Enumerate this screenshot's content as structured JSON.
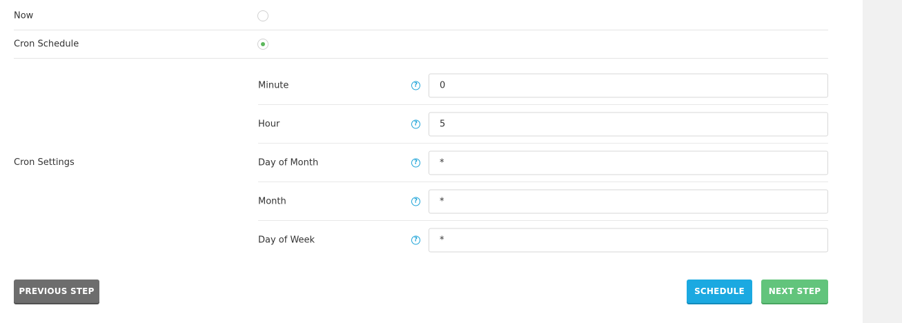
{
  "options": {
    "now_label": "Now",
    "cron_schedule_label": "Cron Schedule",
    "selected": "Cron Schedule"
  },
  "cron": {
    "section_label": "Cron Settings",
    "fields": [
      {
        "label": "Minute",
        "value": "0"
      },
      {
        "label": "Hour",
        "value": "5"
      },
      {
        "label": "Day of Month",
        "value": "*"
      },
      {
        "label": "Month",
        "value": "*"
      },
      {
        "label": "Day of Week",
        "value": "*"
      }
    ],
    "help_icon": "question-circle-icon",
    "help_glyph": "?"
  },
  "buttons": {
    "previous": "PREVIOUS STEP",
    "schedule": "SCHEDULE",
    "next": "NEXT STEP"
  },
  "colors": {
    "radio_selected": "#5cb85c",
    "help_icon": "#1ca3d8",
    "previous_button": "#6d6d6d",
    "schedule_button": "#1ba9e1",
    "next_button": "#62c47c"
  }
}
